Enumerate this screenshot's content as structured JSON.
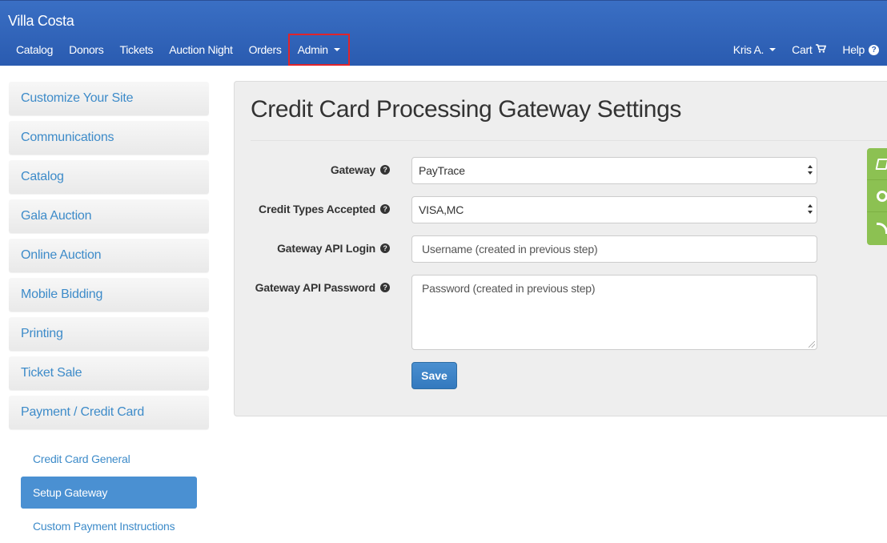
{
  "app": {
    "title": "Villa Costa"
  },
  "nav": {
    "left": [
      {
        "label": "Catalog"
      },
      {
        "label": "Donors"
      },
      {
        "label": "Tickets"
      },
      {
        "label": "Auction Night"
      },
      {
        "label": "Orders"
      },
      {
        "label": "Admin"
      }
    ],
    "user_label": "Kris A.",
    "cart_label": "Cart",
    "help_label": "Help"
  },
  "sidebar": {
    "items": [
      {
        "label": "Customize Your Site"
      },
      {
        "label": "Communications"
      },
      {
        "label": "Catalog"
      },
      {
        "label": "Gala Auction"
      },
      {
        "label": "Online Auction"
      },
      {
        "label": "Mobile Bidding"
      },
      {
        "label": "Printing"
      },
      {
        "label": "Ticket Sale"
      },
      {
        "label": "Payment / Credit Card"
      }
    ],
    "submenu": [
      {
        "label": "Credit Card General"
      },
      {
        "label": "Setup Gateway",
        "active": true
      },
      {
        "label": "Custom Payment Instructions"
      }
    ]
  },
  "main": {
    "title": "Credit Card Processing Gateway Settings",
    "fields": {
      "gateway": {
        "label": "Gateway",
        "value": "PayTrace"
      },
      "credit_types": {
        "label": "Credit Types Accepted",
        "value": "VISA,MC"
      },
      "api_login": {
        "label": "Gateway API Login",
        "placeholder": "Username (created in previous step)"
      },
      "api_password": {
        "label": "Gateway API Password",
        "placeholder": "Password (created in previous step)"
      }
    },
    "save_label": "Save"
  },
  "colors": {
    "navbar": "#2f62b8",
    "link": "#3d8bc9",
    "active_sub": "#4a90d2",
    "highlight": "#e0242b",
    "float_tabs": "#8cc152"
  },
  "icons": {
    "user_dropdown": "caret-down-icon",
    "admin_dropdown": "caret-down-icon",
    "cart": "shopping-cart-icon",
    "help": "question-circle-icon",
    "field_help": "question-circle-icon",
    "float_tab_1": "book-icon",
    "float_tab_2": "life-ring-icon",
    "float_tab_3": "rss-icon"
  }
}
